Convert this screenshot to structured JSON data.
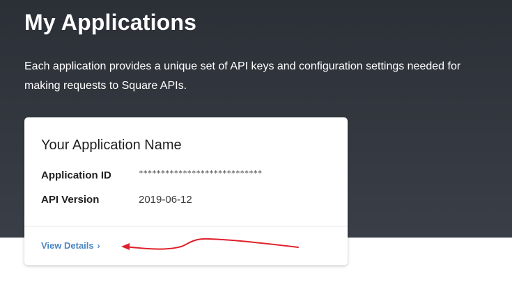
{
  "page": {
    "title": "My Applications",
    "description": "Each application provides a unique set of API keys and configuration settings needed for making requests to Square APIs."
  },
  "application_card": {
    "name": "Your Application Name",
    "fields": [
      {
        "label": "Application ID",
        "value": "****************************"
      },
      {
        "label": "API Version",
        "value": "2019-06-12"
      }
    ],
    "view_details_label": "View Details",
    "view_details_chevron": "›"
  },
  "colors": {
    "hero_background": "#2f333a",
    "link": "#4a87c2",
    "annotation_arrow": "#e0202a"
  }
}
